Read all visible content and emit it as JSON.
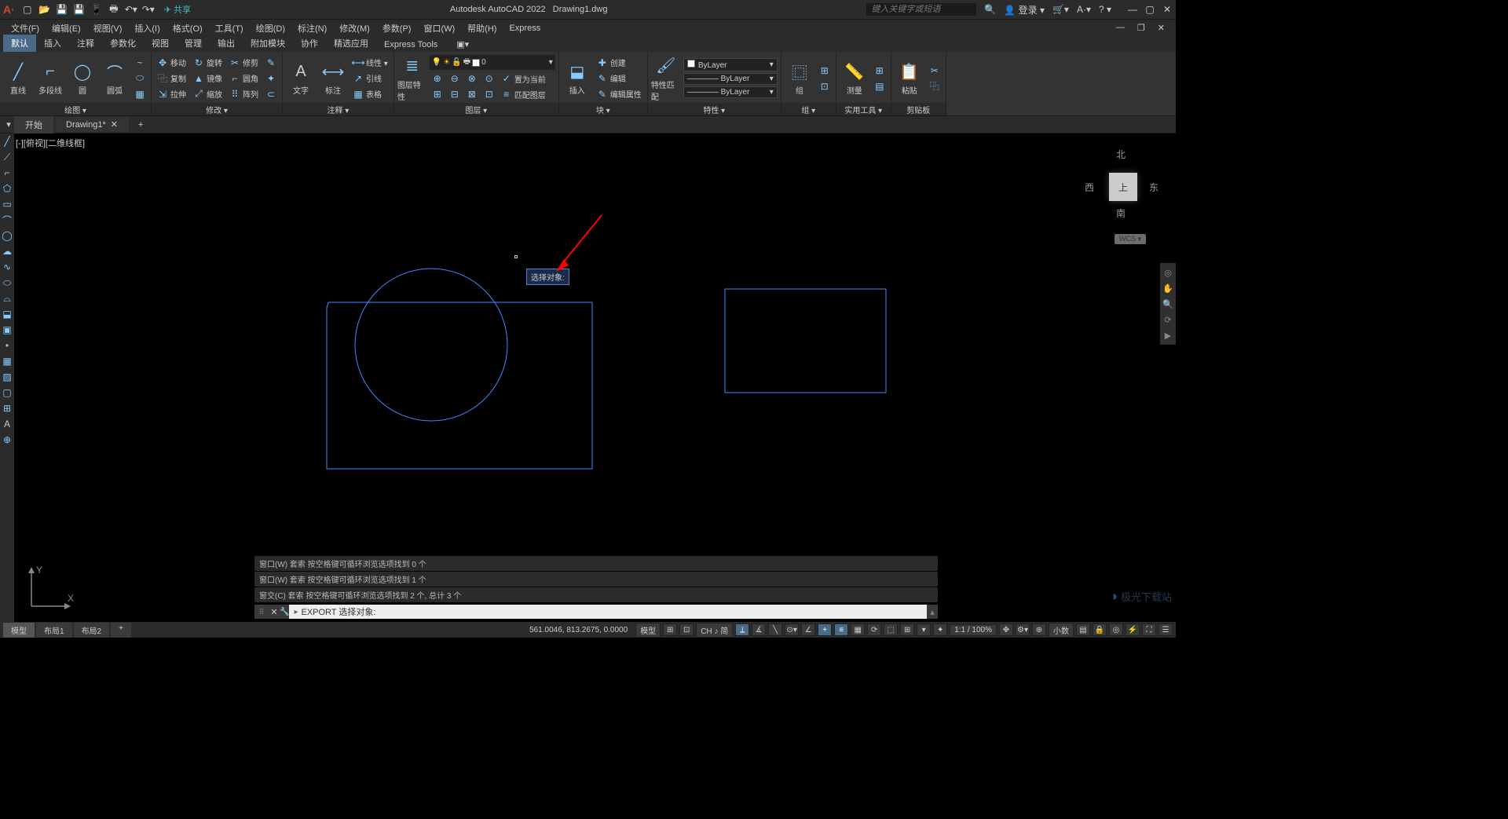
{
  "titlebar": {
    "app": "Autodesk AutoCAD 2022",
    "filename": "Drawing1.dwg",
    "share": "共享",
    "search_placeholder": "键入关键字或短语",
    "login": "登录"
  },
  "menubar": {
    "items": [
      "文件(F)",
      "编辑(E)",
      "视图(V)",
      "插入(I)",
      "格式(O)",
      "工具(T)",
      "绘图(D)",
      "标注(N)",
      "修改(M)",
      "参数(P)",
      "窗口(W)",
      "帮助(H)",
      "Express"
    ]
  },
  "ribbontabs": {
    "items": [
      "默认",
      "插入",
      "注释",
      "参数化",
      "视图",
      "管理",
      "输出",
      "附加模块",
      "协作",
      "精选应用",
      "Express Tools"
    ],
    "active": 0
  },
  "ribbon": {
    "draw": {
      "label": "绘图 ▾",
      "line": "直线",
      "polyline": "多段线",
      "circle": "圆",
      "arc": "圆弧"
    },
    "modify": {
      "label": "修改 ▾",
      "move": "移动",
      "rotate": "旋转",
      "trim": "修剪",
      "copy": "复制",
      "mirror": "镜像",
      "fillet": "圆角",
      "stretch": "拉伸",
      "scale": "缩放",
      "array": "阵列"
    },
    "annot": {
      "label": "注释 ▾",
      "text": "文字",
      "dim": "标注",
      "leader": "引线",
      "table": "表格"
    },
    "layer": {
      "label": "图层 ▾",
      "prop": "图层特性",
      "current": "0",
      "setcurrent": "置为当前",
      "match": "匹配图层"
    },
    "block": {
      "label": "块 ▾",
      "insert": "插入",
      "create": "创建",
      "edit": "编辑",
      "editattr": "编辑属性"
    },
    "props": {
      "label": "特性 ▾",
      "match": "特性匹配",
      "bylayer": "ByLayer"
    },
    "group": {
      "label": "组 ▾",
      "group": "组"
    },
    "util": {
      "label": "实用工具 ▾",
      "measure": "测量"
    },
    "clip": {
      "label": "剪贴板",
      "paste": "粘贴"
    }
  },
  "filetabs": {
    "tabs": [
      {
        "label": "开始"
      },
      {
        "label": "Drawing1*",
        "active": true
      }
    ]
  },
  "viewport": {
    "label": "[-][俯视][二维线框]"
  },
  "viewcube": {
    "n": "北",
    "s": "南",
    "e": "东",
    "w": "西",
    "top": "上",
    "wcs": "WCS ▾"
  },
  "tooltip": {
    "text": "选择对象:"
  },
  "cmd_history": [
    "窗口(W) 套索  按空格键可循环浏览选项找到 0 个",
    "窗口(W) 套索  按空格键可循环浏览选项找到 1 个",
    "窗交(C) 套索  按空格键可循环浏览选项找到 2 个, 总计 3 个"
  ],
  "cmdline": {
    "prompt": "EXPORT 选择对象:"
  },
  "statusbar": {
    "tabs": [
      "模型",
      "布局1",
      "布局2",
      "+"
    ],
    "coords": "561.0046, 813.2675, 0.0000",
    "model": "模型",
    "ime": "CH ♪ 简",
    "scale": "1:1 / 100%",
    "decimal": "小数"
  },
  "watermark": "极光下载站"
}
